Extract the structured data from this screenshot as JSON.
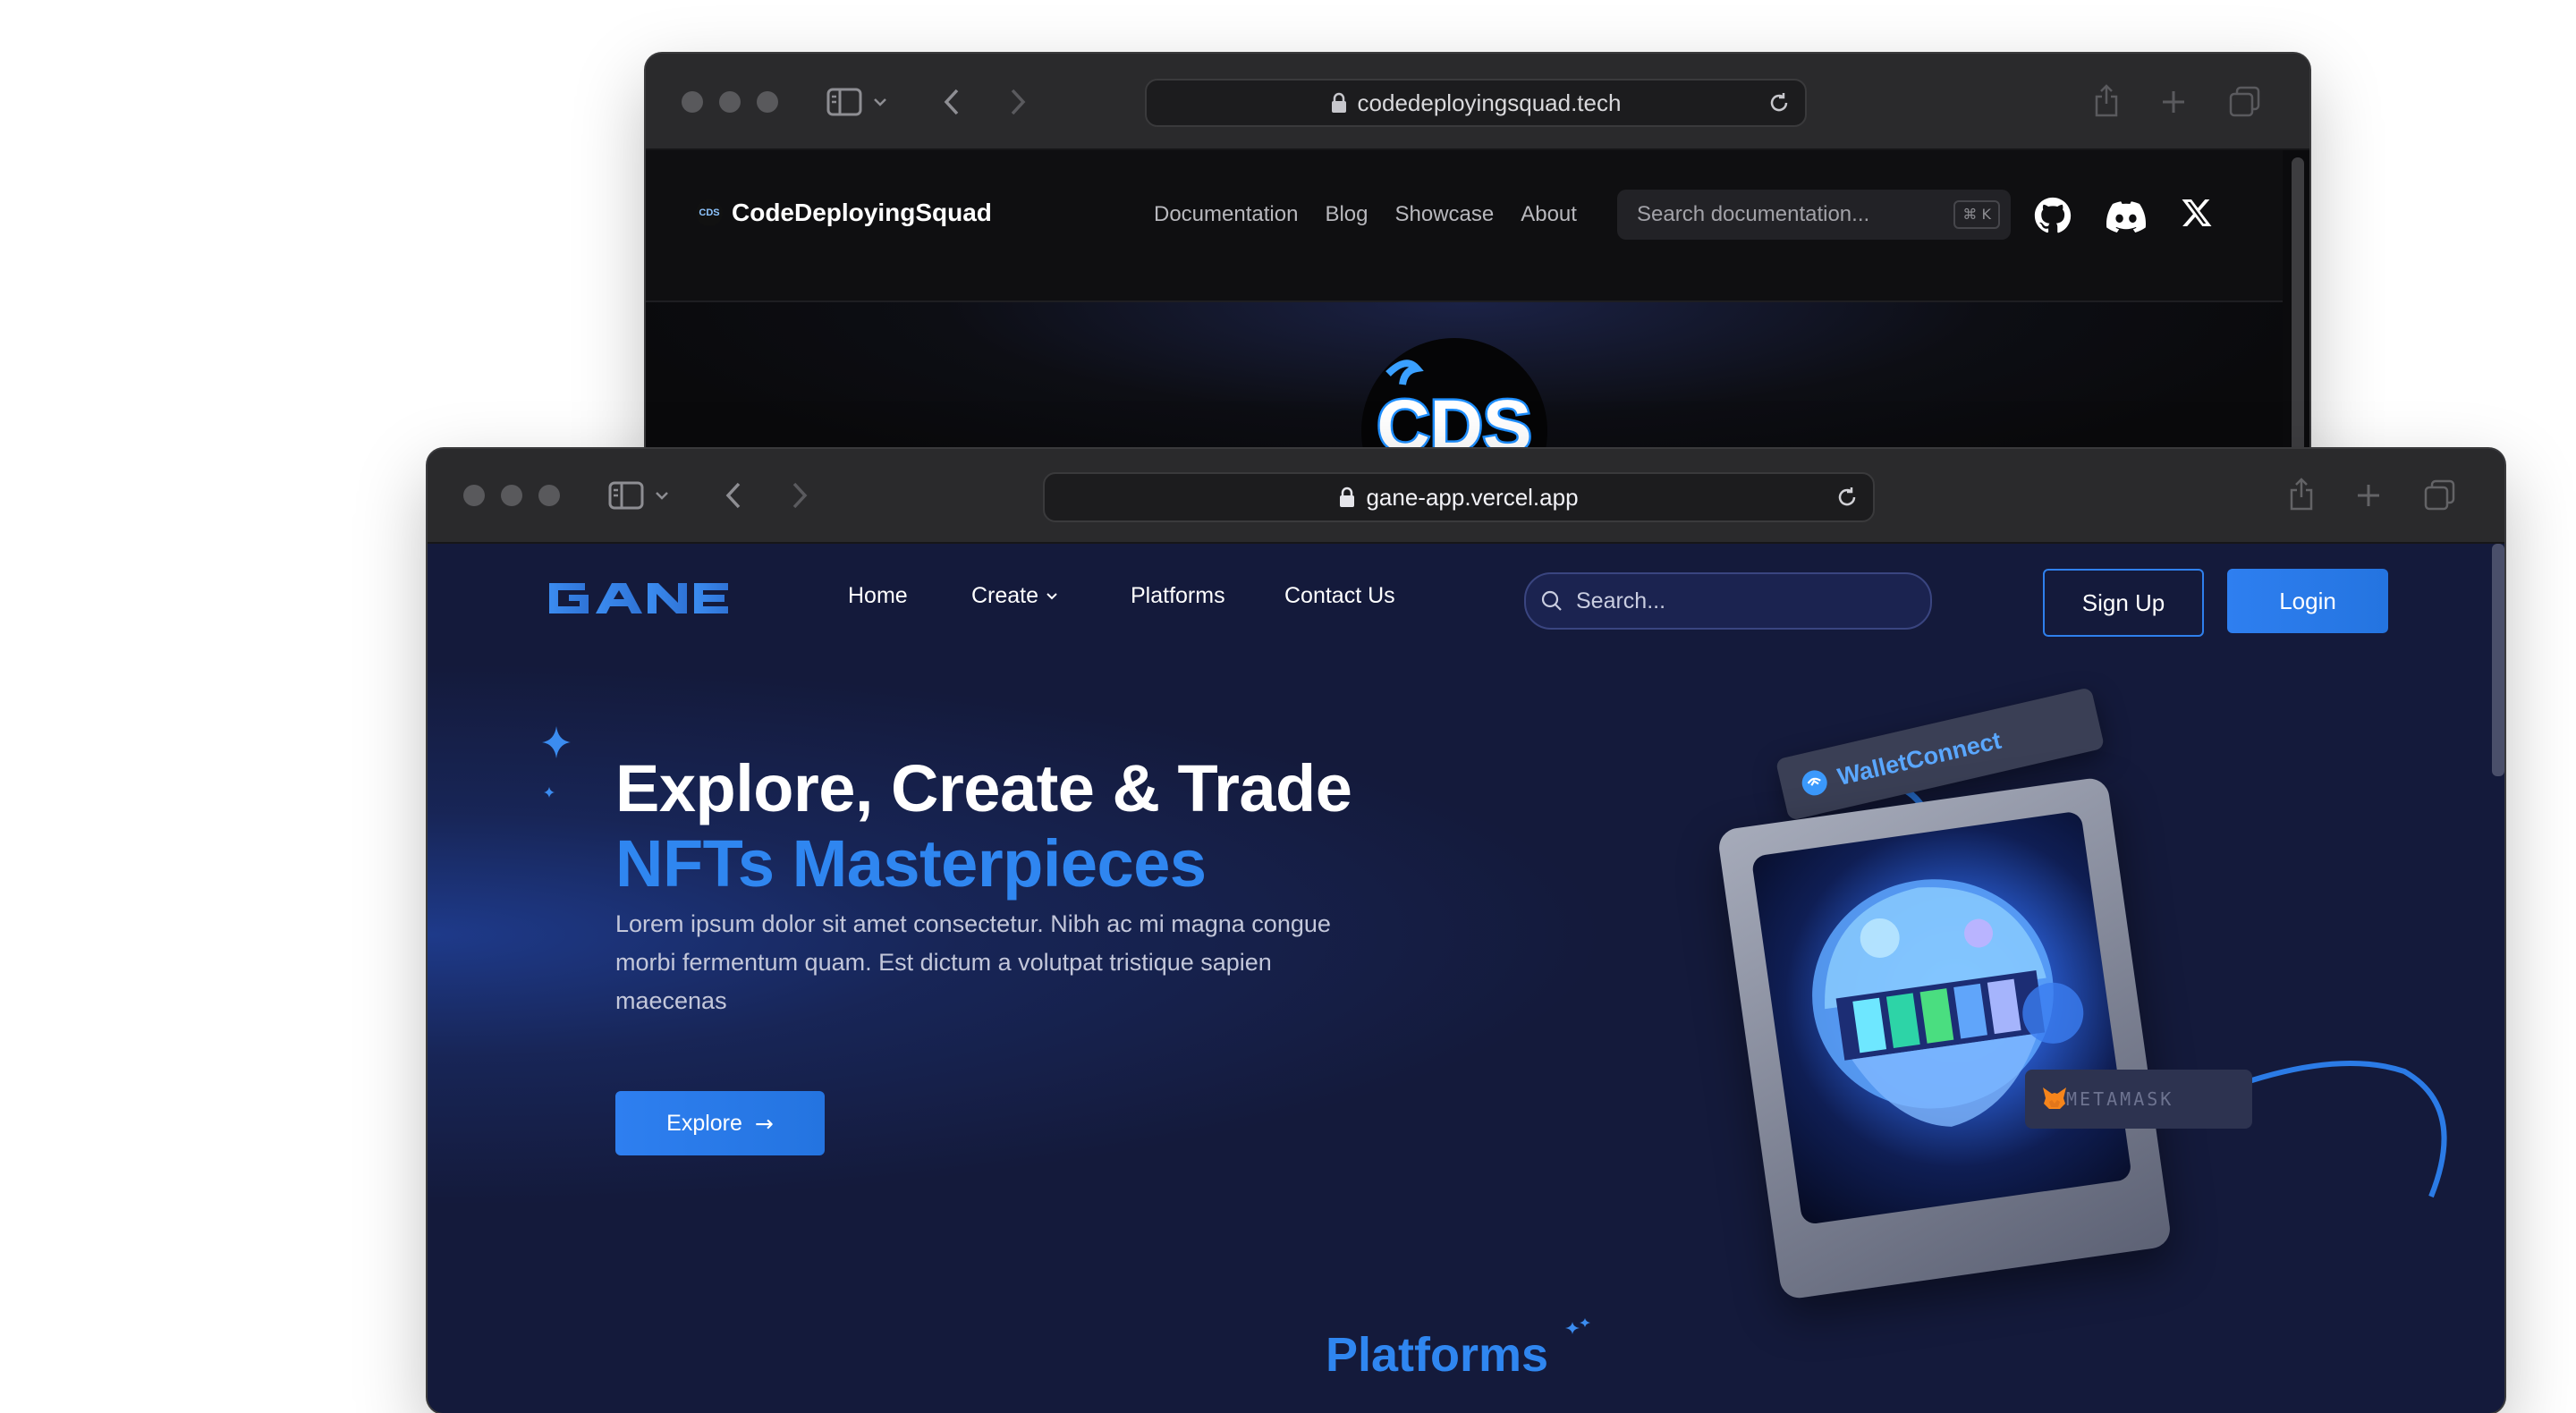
{
  "back_window": {
    "url": "codedeployingsquad.tech",
    "site": {
      "brand": "CodeDeployingSquad",
      "brand_icon_text": "CDS",
      "nav": [
        "Documentation",
        "Blog",
        "Showcase",
        "About"
      ],
      "search_placeholder": "Search documentation...",
      "search_shortcut": "⌘ K",
      "social_icons": [
        "github-icon",
        "discord-icon",
        "x-icon"
      ],
      "logo_text": "CDS"
    }
  },
  "front_window": {
    "url": "gane-app.vercel.app",
    "site": {
      "brand": "GANE",
      "nav": [
        "Home",
        "Create",
        "Platforms",
        "Contact Us"
      ],
      "search_placeholder": "Search...",
      "signup_label": "Sign Up",
      "login_label": "Login",
      "hero": {
        "title_line1": "Explore, Create & Trade",
        "title_line2": "NFTs Masterpieces",
        "description": "Lorem ipsum dolor sit amet consectetur. Nibh ac mi magna congue morbi fermentum quam. Est dictum a volutpat tristique sapien maecenas",
        "explore_label": "Explore",
        "explore_arrow": "→"
      },
      "badges": {
        "walletconnect": "WalletConnect",
        "metamask": "METAMASK"
      },
      "section_title": "Platforms"
    }
  },
  "colors": {
    "accent_blue": "#2f80ed",
    "page_bg": "#141a3b",
    "chrome_bg": "#2a2a2c"
  }
}
